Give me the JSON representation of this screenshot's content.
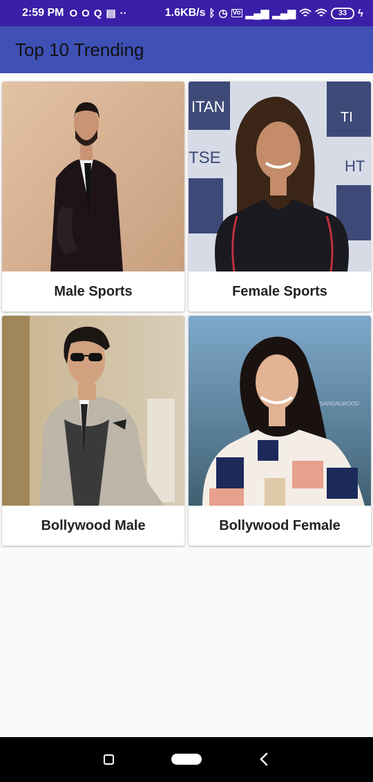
{
  "status_bar": {
    "time": "2:59 PM",
    "network_speed": "1.6KB/s",
    "battery": "33",
    "icons": [
      "o-icon",
      "o-icon",
      "q-icon",
      "card-icon",
      "dots-icon",
      "bluetooth-icon",
      "alarm-icon",
      "volte-icon",
      "signal-icon",
      "signal-icon",
      "wifi-icon",
      "wifi-icon",
      "battery-icon",
      "charging-icon"
    ]
  },
  "app_bar": {
    "title": "Top 10 Trending"
  },
  "categories": [
    {
      "label": "Male Sports"
    },
    {
      "label": "Female Sports"
    },
    {
      "label": "Bollywood Male"
    },
    {
      "label": "Bollywood Female"
    }
  ],
  "colors": {
    "status_bar": "#3a1fa8",
    "app_bar": "#3f51b5",
    "background": "#fafafa"
  }
}
